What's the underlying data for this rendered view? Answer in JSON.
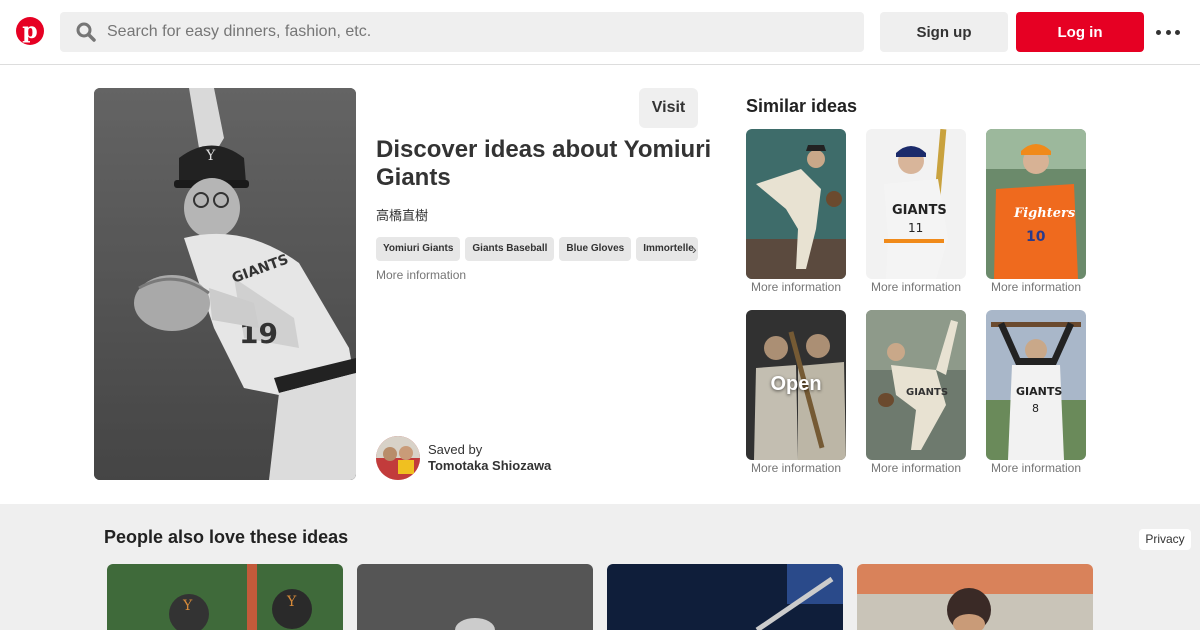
{
  "header": {
    "logo_letter": "p",
    "search_placeholder": "Search for easy dinners, fashion, etc.",
    "signup_label": "Sign up",
    "login_label": "Log in",
    "brand_color": "#e60023"
  },
  "pin": {
    "visit_label": "Visit",
    "title": "Discover ideas about Yomiuri Giants",
    "subtitle": "高橋直樹",
    "tags": [
      "Yomiuri Giants",
      "Giants Baseball",
      "Blue Gloves",
      "Immortelle"
    ],
    "more_info_label": "More information",
    "saved_by_label": "Saved by",
    "saver_name": "Tomotaka Shiozawa"
  },
  "similar": {
    "title": "Similar ideas",
    "more_info_label": "More information",
    "open_label": "Open"
  },
  "bottom": {
    "title": "People also love these ideas",
    "privacy_label": "Privacy"
  }
}
